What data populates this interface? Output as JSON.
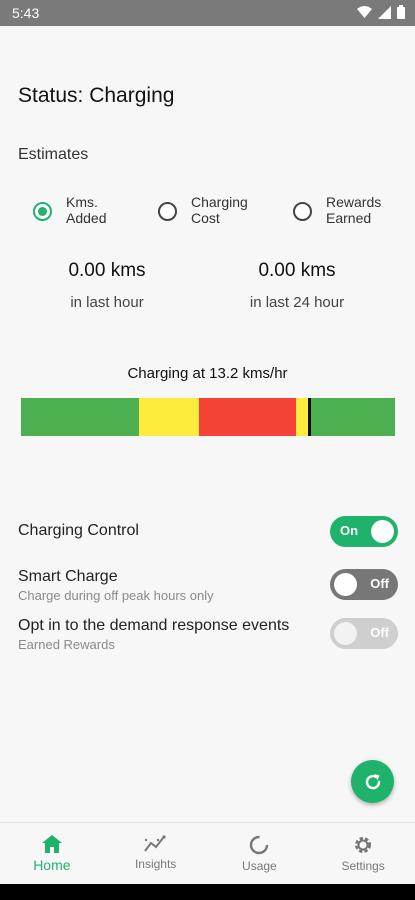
{
  "status_bar": {
    "time": "5:43"
  },
  "page": {
    "title": "Status: Charging",
    "estimates_label": "Estimates"
  },
  "estimate_options": [
    {
      "line1": "Kms.",
      "line2": "Added",
      "selected": true
    },
    {
      "line1": "Charging",
      "line2": "Cost",
      "selected": false
    },
    {
      "line1": "Rewards",
      "line2": "Earned",
      "selected": false
    }
  ],
  "metrics": [
    {
      "value": "0.00 kms",
      "label": "in last hour"
    },
    {
      "value": "0.00 kms",
      "label": "in last 24 hour"
    }
  ],
  "rate": {
    "title": "Charging at 13.2 kms/hr",
    "segments": [
      {
        "color": "#4caf50",
        "fraction": 0.315
      },
      {
        "color": "#ffeb3b",
        "fraction": 0.16
      },
      {
        "color": "#f44336",
        "fraction": 0.26
      },
      {
        "color": "#ffeb3b",
        "fraction": 0.04
      },
      {
        "color": "#4caf50",
        "fraction": 0.225
      }
    ]
  },
  "controls": {
    "charging_control": {
      "title": "Charging Control",
      "toggle": "On"
    },
    "smart_charge": {
      "title": "Smart Charge",
      "desc": "Charge during off peak hours only",
      "toggle": "Off"
    },
    "demand_response": {
      "title": "Opt in to the demand response events",
      "desc": "Earned Rewards",
      "toggle": "Off"
    }
  },
  "nav": {
    "home": "Home",
    "insights": "Insights",
    "usage": "Usage",
    "settings": "Settings"
  },
  "colors": {
    "accent": "#1fb26a"
  }
}
